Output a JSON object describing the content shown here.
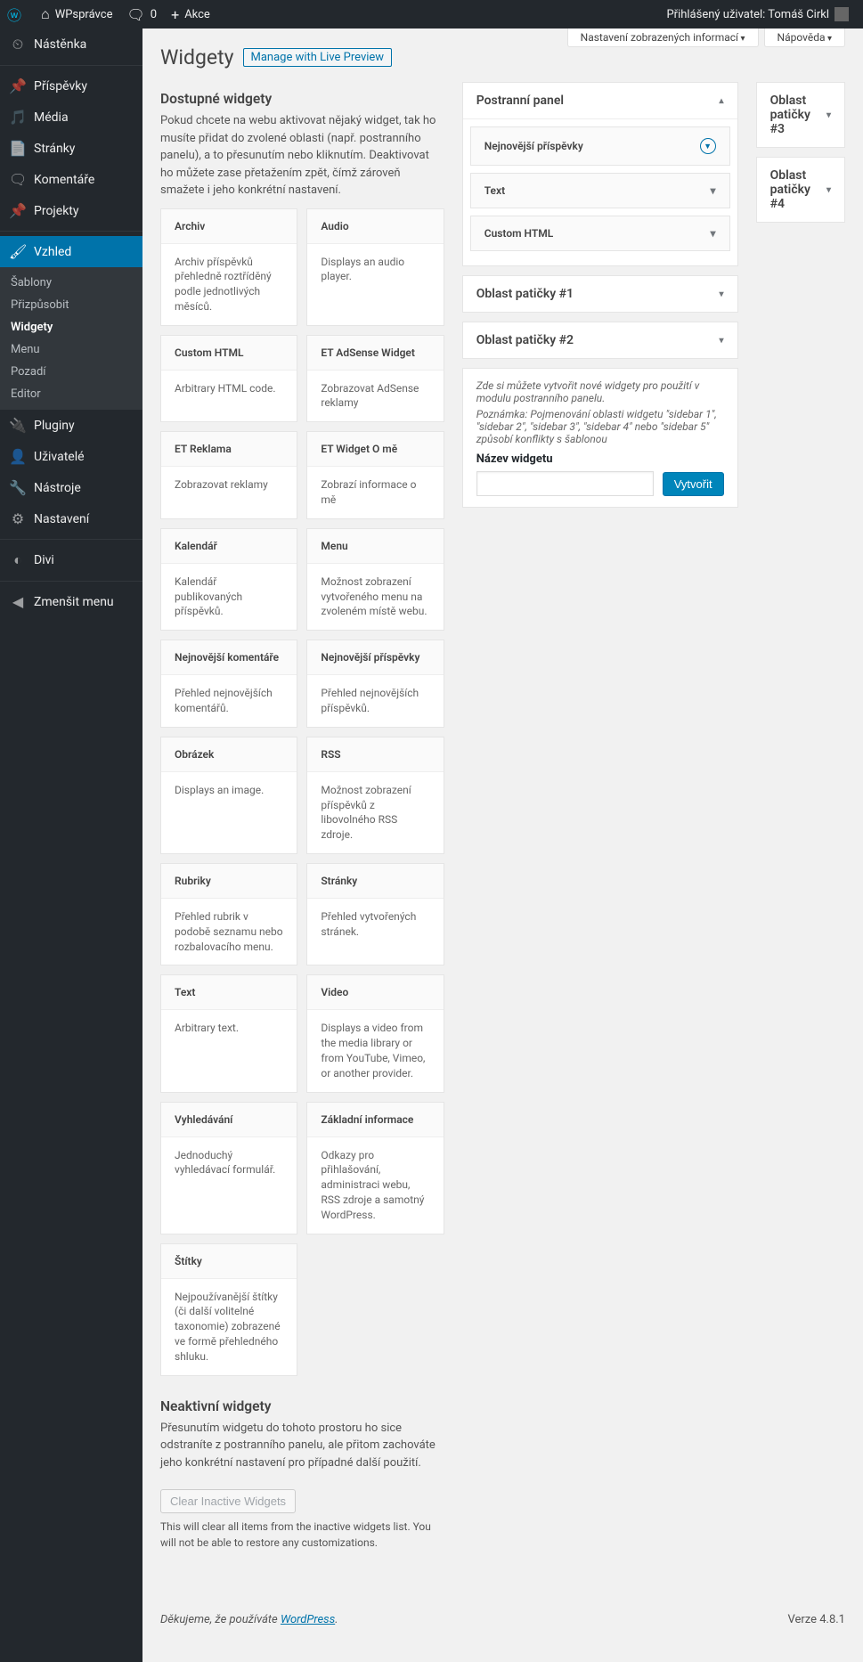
{
  "adminbar": {
    "site": "WPsprávce",
    "comments": "0",
    "new": "Akce",
    "greeting": "Přihlášený uživatel: Tomáš Cirkl"
  },
  "screenTabs": {
    "options": "Nastavení zobrazených informací",
    "help": "Nápověda"
  },
  "sidebar": {
    "dashboard": "Nástěnka",
    "posts": "Příspěvky",
    "media": "Média",
    "pages": "Stránky",
    "comments": "Komentáře",
    "projects": "Projekty",
    "appearance": "Vzhled",
    "plugins": "Pluginy",
    "users": "Uživatelé",
    "tools": "Nástroje",
    "settings": "Nastavení",
    "divi": "Divi",
    "collapse": "Zmenšit menu",
    "sub": {
      "themes": "Šablony",
      "customize": "Přizpůsobit",
      "widgets": "Widgety",
      "menus": "Menu",
      "background": "Pozadí",
      "editor": "Editor"
    }
  },
  "page": {
    "title": "Widgety",
    "live_preview": "Manage with Live Preview",
    "available_h": "Dostupné widgety",
    "available_desc": "Pokud chcete na webu aktivovat nějaký widget, tak ho musíte přidat do zvolené oblasti (např. postranního panelu), a to přesunutím nebo kliknutím. Deaktivovat ho můžete zase přetažením zpět, čímž zároveň smažete i jeho konkrétní nastavení.",
    "inactive_h": "Neaktivní widgety",
    "inactive_desc": "Přesunutím widgetu do tohoto prostoru ho sice odstraníte z postranního panelu, ale přitom zachováte jeho konkrétní nastavení pro případné další použití.",
    "clear_btn": "Clear Inactive Widgets",
    "clear_desc": "This will clear all items from the inactive widgets list. You will not be able to restore any customizations."
  },
  "widgets": [
    {
      "t": "Archiv",
      "d": "Archiv příspěvků přehledně roztříděný podle jednotlivých měsíců."
    },
    {
      "t": "Audio",
      "d": "Displays an audio player."
    },
    {
      "t": "Custom HTML",
      "d": "Arbitrary HTML code."
    },
    {
      "t": "ET AdSense Widget",
      "d": "Zobrazovat AdSense reklamy"
    },
    {
      "t": "ET Reklama",
      "d": "Zobrazovat reklamy"
    },
    {
      "t": "ET Widget O mě",
      "d": "Zobrazí informace o mě"
    },
    {
      "t": "Kalendář",
      "d": "Kalendář publikovaných příspěvků."
    },
    {
      "t": "Menu",
      "d": "Možnost zobrazení vytvořeného menu na zvoleném místě webu."
    },
    {
      "t": "Nejnovější komentáře",
      "d": "Přehled nejnovějších komentářů."
    },
    {
      "t": "Nejnovější příspěvky",
      "d": "Přehled nejnovějších příspěvků."
    },
    {
      "t": "Obrázek",
      "d": "Displays an image."
    },
    {
      "t": "RSS",
      "d": "Možnost zobrazení příspěvků z libovolného RSS zdroje."
    },
    {
      "t": "Rubriky",
      "d": "Přehled rubrik v podobě seznamu nebo rozbalovacího menu."
    },
    {
      "t": "Stránky",
      "d": "Přehled vytvořených stránek."
    },
    {
      "t": "Text",
      "d": "Arbitrary text."
    },
    {
      "t": "Video",
      "d": "Displays a video from the media library or from YouTube, Vimeo, or another provider."
    },
    {
      "t": "Vyhledávání",
      "d": "Jednoduchý vyhledávací formulář."
    },
    {
      "t": "Základní informace",
      "d": "Odkazy pro přihlašování, administraci webu, RSS zdroje a samotný WordPress."
    },
    {
      "t": "Štítky",
      "d": "Nejpoužívanější štítky (či další volitelné taxonomie) zobrazené ve formě přehledného shluku."
    }
  ],
  "areas": {
    "primary": {
      "title": "Postranní panel",
      "items": [
        "Nejnovější příspěvky",
        "Text",
        "Custom HTML"
      ]
    },
    "footer1": "Oblast patičky #1",
    "footer2": "Oblast patičky #2",
    "footer3": "Oblast patičky #3",
    "footer4": "Oblast patičky #4"
  },
  "create": {
    "intro": "Zde si můžete vytvořit nové widgety pro použití v modulu postranního panelu.",
    "note": "Poznámka: Pojmenování oblasti widgetu \"sidebar 1\", \"sidebar 2\", \"sidebar 3\", \"sidebar 4\" nebo \"sidebar 5\" způsobí konflikty s šablonou",
    "label": "Název widgetu",
    "btn": "Vytvořit"
  },
  "footer": {
    "thanks": "Děkujeme, že používáte ",
    "wp": "WordPress",
    "version": "Verze 4.8.1"
  }
}
